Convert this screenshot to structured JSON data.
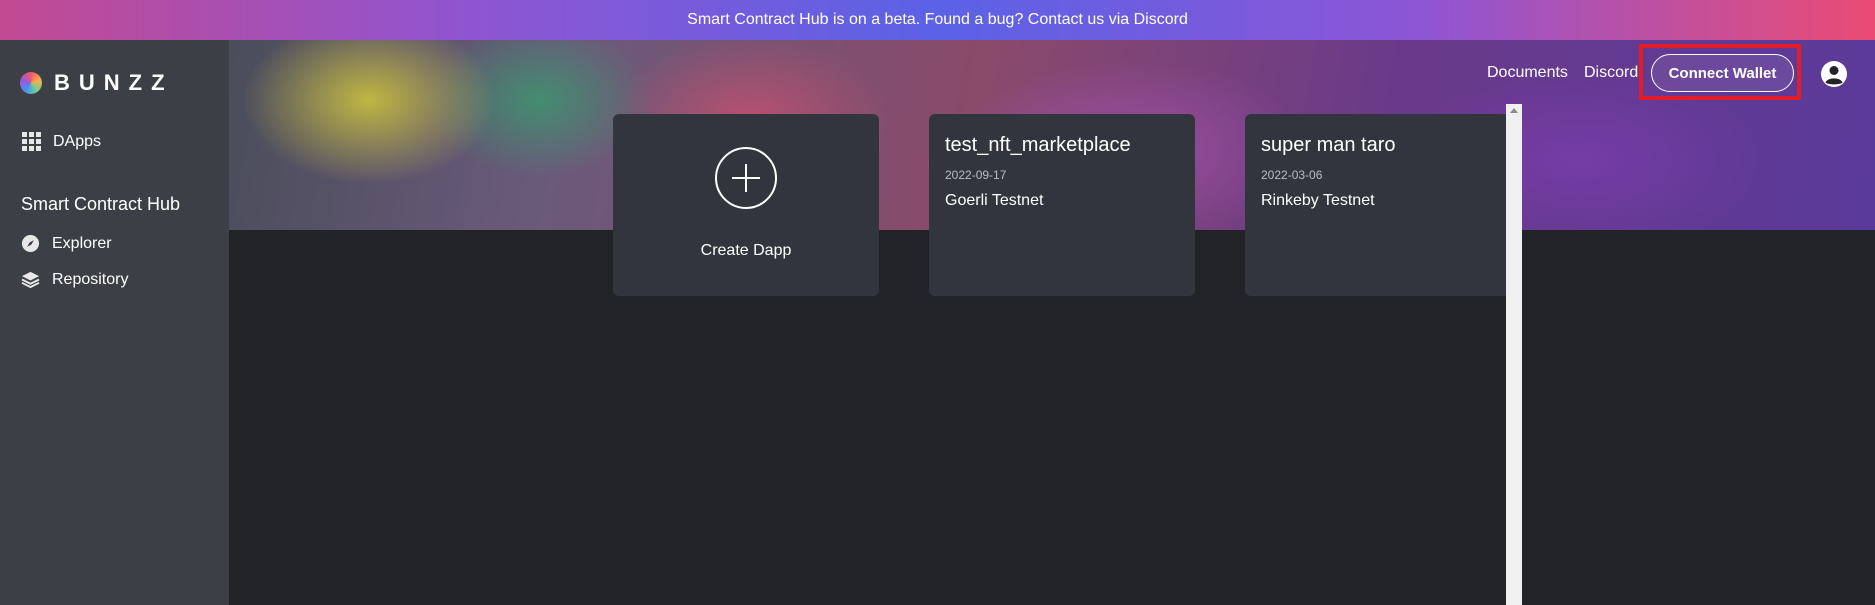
{
  "banner": {
    "text": "Smart Contract Hub is on a beta. Found a bug? Contact us via Discord"
  },
  "sidebar": {
    "logo_text": "BUNZZ",
    "dapps_label": "DApps",
    "section_heading": "Smart Contract Hub",
    "items": [
      {
        "label": "Explorer",
        "icon": "compass-icon"
      },
      {
        "label": "Repository",
        "icon": "layers-icon"
      }
    ]
  },
  "header": {
    "documents_label": "Documents",
    "discord_label": "Discord",
    "connect_wallet_label": "Connect Wallet",
    "user_icon": "user-circle-icon"
  },
  "cards": {
    "create_label": "Create Dapp",
    "projects": [
      {
        "title": "test_nft_marketplace",
        "date": "2022-09-17",
        "network": "Goerli Testnet"
      },
      {
        "title": "super man taro",
        "date": "2022-03-06",
        "network": "Rinkeby Testnet"
      }
    ]
  },
  "colors": {
    "page_bg": "#222327",
    "sidebar_bg": "#3d3f46",
    "card_bg": "#32353d",
    "highlight": "#e11d2a"
  }
}
